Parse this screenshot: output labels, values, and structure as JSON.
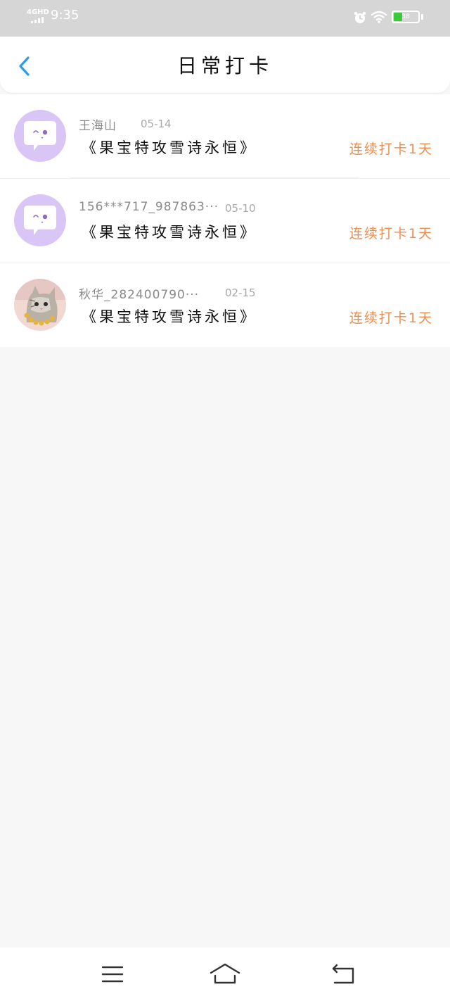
{
  "status_bar": {
    "network": "4GHD",
    "time": "9:35",
    "battery": "38",
    "battery_level": 0.38,
    "icons": [
      "signal-icon",
      "alarm-icon",
      "wifi-icon",
      "battery-icon"
    ]
  },
  "header": {
    "title": "日常打卡",
    "back_icon": "chevron-left-icon"
  },
  "colors": {
    "accent_back": "#2d9be6",
    "streak_orange": "#f08c4b",
    "avatar_purple": "#d9c5f6",
    "status_bar_bg": "#d6d6d6",
    "page_bg": "#f8f7f8"
  },
  "records": [
    {
      "user": "王海山",
      "date": "05-14",
      "book": "《果宝特攻雪诗永恒》",
      "streak": "连续打卡1天",
      "avatar": "default-chat-avatar-icon"
    },
    {
      "user": "156***717_987863···",
      "date": "05-10",
      "book": "《果宝特攻雪诗永恒》",
      "streak": "连续打卡1天",
      "avatar": "default-chat-avatar-icon"
    },
    {
      "user": "秋华_282400790···",
      "date": "02-15",
      "book": "《果宝特攻雪诗永恒》",
      "streak": "连续打卡1天",
      "avatar": "cat-photo-avatar"
    }
  ],
  "system_nav": {
    "icons": [
      "menu-icon",
      "home-icon",
      "back-icon"
    ]
  }
}
